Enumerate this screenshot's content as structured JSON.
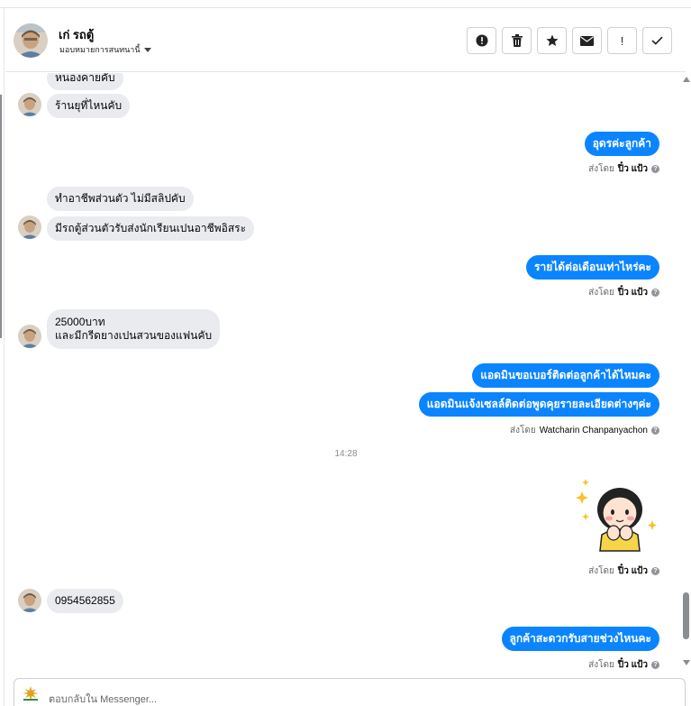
{
  "contact": {
    "name": "เก่ รถตู้",
    "assign_label": "มอบหมายการสนทนานี้"
  },
  "toolbar": {
    "spam_label": "Mark as spam",
    "delete_label": "Delete",
    "star_label": "Star",
    "unread_label": "Mark as unread",
    "follow_up_label": "!",
    "done_label": "Done"
  },
  "messages": [
    {
      "side": "in",
      "text": "หนองคายคับ"
    },
    {
      "side": "in",
      "text": "ร้านยุที่ไหนคับ"
    },
    {
      "side": "out",
      "text": "อุดรค่ะลูกค้า",
      "sent_prefix": "ส่งโดย",
      "sender": "ปิ๋ว แป้ว"
    },
    {
      "side": "in",
      "text": "ทำอาชีพส่วนตัว ไม่มีสลิปคับ"
    },
    {
      "side": "in",
      "text": "มีรถตู้ส่วนตัวรับส่งนักเรียนเปนอาชีพอิสระ"
    },
    {
      "side": "out",
      "text": "รายได้ต่อเดือนเท่าไหร่คะ",
      "sent_prefix": "ส่งโดย",
      "sender": "ปิ๋ว แป้ว"
    },
    {
      "side": "in",
      "text_line1": "25000บาท",
      "text_line2": "และมีกรีดยางเปนสวนของแฟนคับ"
    },
    {
      "side": "out",
      "text": "แอดมินขอเบอร์ติดต่อลูกค้าได้ไหมคะ"
    },
    {
      "side": "out",
      "text": "แอดมินแจ้งเซลล์ติดต่อพูดคุยรายละเอียดต่างๆค่ะ",
      "sent_prefix": "ส่งโดย",
      "sender": "Watcharin Chanpanyachon"
    },
    {
      "side": "out",
      "sticker": "girl-sticker",
      "sent_prefix": "ส่งโดย",
      "sender": "ปิ๋ว แป้ว"
    },
    {
      "side": "in",
      "text": "0954562855"
    },
    {
      "side": "out",
      "text": "ลูกค้าสะดวกรับสายช่วงไหนคะ",
      "sent_prefix": "ส่งโดย",
      "sender": "ปิ๋ว แป้ว"
    }
  ],
  "timestamp": "14:28",
  "composer": {
    "placeholder": "ตอบกลับใน Messenger..."
  },
  "colors": {
    "outgoing_bubble": "#0b84ff",
    "incoming_bubble": "#e9ebef",
    "border": "#ccd0d5"
  },
  "icons": {
    "tool_spam": "exclamation-circle-icon",
    "tool_delete": "trash-icon",
    "tool_star": "star-icon",
    "tool_unread": "envelope-icon",
    "tool_follow": "exclamation-icon",
    "tool_done": "check-icon",
    "info": "info-icon"
  }
}
